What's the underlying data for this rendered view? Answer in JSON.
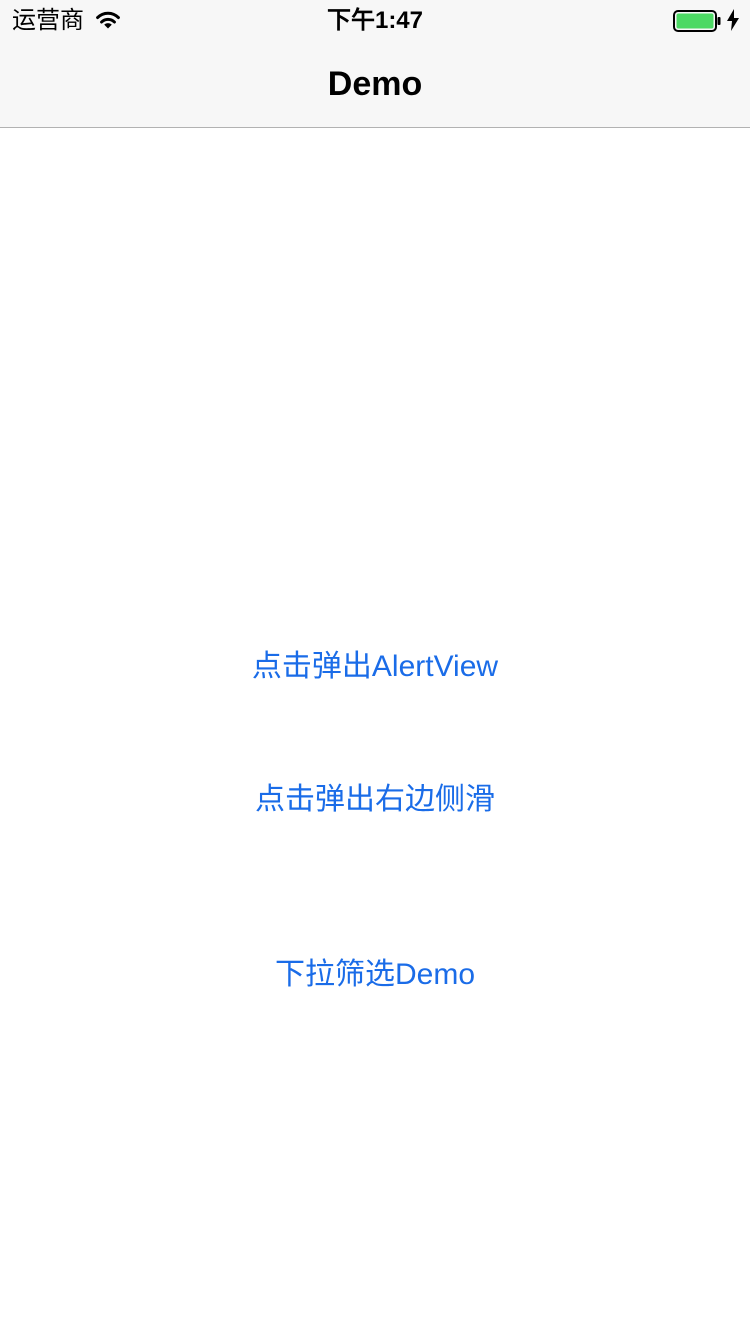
{
  "status_bar": {
    "carrier": "运营商",
    "time": "下午1:47",
    "wifi_icon": "wifi-icon",
    "battery_icon": "battery-icon",
    "battery_level": 1.0,
    "battery_color": "#4cd964",
    "charging_icon": "charging-bolt-icon"
  },
  "nav_bar": {
    "title": "Demo"
  },
  "buttons": {
    "alert_view": "点击弹出AlertView",
    "right_side_slide": "点击弹出右边侧滑",
    "dropdown_filter": "下拉筛选Demo"
  },
  "colors": {
    "link": "#1a6ce8",
    "nav_background": "#f7f7f7"
  }
}
